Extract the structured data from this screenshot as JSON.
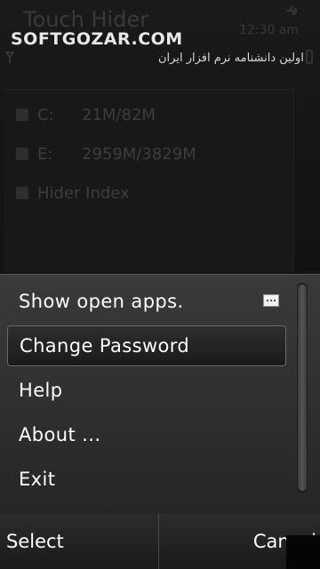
{
  "app": {
    "title": "Touch Hider",
    "time": "12:30 am"
  },
  "watermark": {
    "brand": "SOFTGOZAR.COM",
    "tagline": "اولین دانشنامه نرم افزار ایران"
  },
  "drives": [
    {
      "label": "C:",
      "space": "21M/82M"
    },
    {
      "label": "E:",
      "space": "2959M/3829M"
    }
  ],
  "hider_index": {
    "label": "Hider Index"
  },
  "menu": {
    "items": [
      {
        "label": "Show open apps.",
        "has_submenu": true,
        "selected": false
      },
      {
        "label": "Change Password",
        "has_submenu": false,
        "selected": true
      },
      {
        "label": "Help",
        "has_submenu": false,
        "selected": false
      },
      {
        "label": "About ...",
        "has_submenu": false,
        "selected": false
      },
      {
        "label": "Exit",
        "has_submenu": false,
        "selected": false
      }
    ]
  },
  "softkeys": {
    "left": "Select",
    "right": "Cancel"
  },
  "icons": {
    "usb": "usb-icon",
    "signal": "signal-icon",
    "battery": "battery-icon",
    "submenu": "submenu-icon"
  }
}
